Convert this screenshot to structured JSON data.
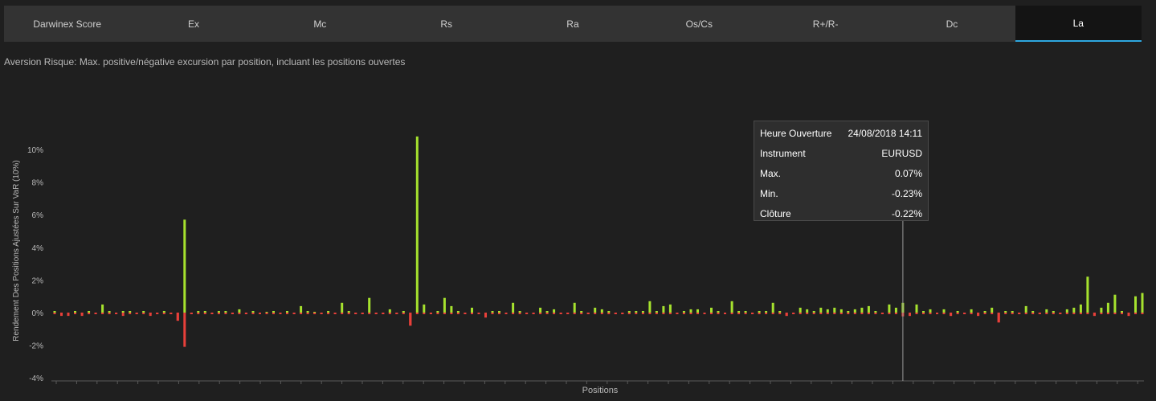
{
  "tabs": [
    "Darwinex Score",
    "Ex",
    "Mc",
    "Rs",
    "Ra",
    "Os/Cs",
    "R+/R-",
    "Dc",
    "La"
  ],
  "active_tab": 8,
  "subtitle": "Aversion Risque: Max. positive/négative excursion par position, incluant les positions ouvertes",
  "tooltip": {
    "rows": [
      {
        "label": "Heure Ouverture",
        "value": "24/08/2018 14:11"
      },
      {
        "label": "Instrument",
        "value": "EURUSD"
      },
      {
        "label": "Max.",
        "value": "0.07%"
      },
      {
        "label": "Min.",
        "value": "-0.23%"
      },
      {
        "label": "Clôture",
        "value": "-0.22%"
      }
    ]
  },
  "colors": {
    "positive": "#a6e22e",
    "negative": "#e8403a",
    "accent": "#2ea7e0"
  },
  "chart_data": {
    "type": "bar",
    "xlabel": "Positions",
    "ylabel": "Rendement Des Positions Ajustées Sur VaR (10%)",
    "ylim": [
      -4,
      11
    ],
    "yticks": [
      -4,
      -2,
      0,
      2,
      4,
      6,
      8,
      10
    ],
    "ytick_labels": [
      "-4%",
      "-2%",
      "0%",
      "2%",
      "4%",
      "6%",
      "8%",
      "10%"
    ],
    "grid": false,
    "series": [
      {
        "values": [
          0.1,
          -0.1,
          -0.2,
          0.1,
          -0.1,
          0.1,
          -0.1,
          0.5,
          0.1,
          -0.1,
          0.1,
          0.1,
          -0.1,
          0.1,
          -0.1,
          -0.1,
          0.1,
          -0.1,
          -0.5,
          5.7,
          -0.1,
          0.1,
          0.1,
          -0.1,
          0.1,
          0.1,
          -0.1,
          0.2,
          -0.1,
          0.1,
          -0.1,
          0.05,
          0.1,
          -0.05,
          0.1,
          -0.1,
          0.4,
          0.1,
          0.05,
          -0.1,
          0.1,
          -0.05,
          0.6,
          0.1,
          -0.1,
          -0.1,
          0.9,
          -0.1,
          -0.1,
          0.2,
          -0.1,
          0.1,
          -0.8,
          10.8,
          0.5,
          -0.05,
          0.1,
          0.9,
          0.4,
          0.1,
          -0.1,
          0.3,
          -0.1,
          -0.3,
          0.1,
          0.1,
          -0.1,
          0.6,
          0.1,
          -0.1,
          -0.1,
          0.3,
          0.1,
          0.2,
          -0.1,
          -0.1,
          0.6,
          0.1,
          -0.1,
          0.3,
          0.2,
          0.1,
          -0.1,
          -0.1,
          0.1,
          0.1,
          0.1,
          0.7,
          0.1,
          0.4,
          0.5,
          -0.1,
          0.1,
          0.2,
          0.2,
          -0.1,
          0.3,
          0.1,
          -0.1,
          0.7,
          0.1,
          0.1,
          -0.1,
          0.1,
          0.1,
          0.6,
          0.1,
          -0.2,
          -0.1,
          0.3,
          0.2,
          0.1,
          0.3,
          0.2,
          0.3,
          0.2,
          0.1,
          0.2,
          0.3,
          0.4,
          0.1,
          -0.1,
          0.5,
          0.3,
          0.6,
          -0.2,
          0.5,
          0.1,
          0.2,
          -0.1,
          0.2,
          -0.2,
          0.1,
          -0.1,
          0.2,
          -0.2,
          0.1,
          0.3,
          -0.6,
          0.1,
          0.1,
          -0.1,
          0.4,
          0.1,
          -0.1,
          0.2,
          0.1,
          -0.1,
          0.2,
          0.3,
          0.5,
          2.2,
          -0.2,
          0.3,
          0.6,
          1.1,
          0.1,
          -0.2,
          1.0,
          1.2
        ]
      },
      {
        "values": [
          -0.1,
          -0.2,
          -0.1,
          -0.1,
          -0.2,
          -0.1,
          -0.1,
          -0.1,
          -0.1,
          -0.1,
          -0.2,
          -0.1,
          -0.1,
          -0.1,
          -0.2,
          -0.1,
          -0.1,
          -0.1,
          -0.5,
          -2.1,
          -0.1,
          -0.1,
          -0.1,
          -0.1,
          -0.1,
          -0.1,
          -0.1,
          -0.1,
          -0.1,
          -0.1,
          -0.1,
          -0.1,
          -0.1,
          -0.1,
          -0.1,
          -0.1,
          -0.1,
          -0.1,
          -0.1,
          -0.1,
          -0.1,
          -0.1,
          -0.1,
          -0.1,
          -0.1,
          -0.1,
          -0.1,
          -0.1,
          -0.1,
          -0.1,
          -0.1,
          -0.1,
          -0.8,
          -0.1,
          -0.1,
          -0.1,
          -0.1,
          -0.1,
          -0.1,
          -0.1,
          -0.1,
          -0.1,
          -0.1,
          -0.3,
          -0.1,
          -0.1,
          -0.1,
          -0.1,
          -0.1,
          -0.1,
          -0.1,
          -0.1,
          -0.1,
          -0.1,
          -0.1,
          -0.1,
          -0.1,
          -0.1,
          -0.1,
          -0.1,
          -0.1,
          -0.1,
          -0.1,
          -0.1,
          -0.1,
          -0.1,
          -0.1,
          -0.1,
          -0.1,
          -0.1,
          -0.1,
          -0.1,
          -0.1,
          -0.1,
          -0.1,
          -0.1,
          -0.1,
          -0.1,
          -0.1,
          -0.1,
          -0.1,
          -0.1,
          -0.1,
          -0.1,
          -0.1,
          -0.1,
          -0.1,
          -0.2,
          -0.1,
          -0.1,
          -0.1,
          -0.1,
          -0.1,
          -0.1,
          -0.1,
          -0.1,
          -0.1,
          -0.1,
          -0.1,
          -0.1,
          -0.1,
          -0.1,
          -0.1,
          -0.1,
          -0.23,
          -0.2,
          -0.1,
          -0.1,
          -0.1,
          -0.1,
          -0.1,
          -0.2,
          -0.1,
          -0.1,
          -0.1,
          -0.2,
          -0.1,
          -0.1,
          -0.6,
          -0.1,
          -0.1,
          -0.1,
          -0.1,
          -0.1,
          -0.1,
          -0.1,
          -0.1,
          -0.1,
          -0.1,
          -0.1,
          -0.1,
          -0.1,
          -0.2,
          -0.1,
          -0.1,
          -0.1,
          -0.1,
          -0.2,
          -0.1,
          -0.1
        ]
      }
    ],
    "highlight_index": 124
  }
}
